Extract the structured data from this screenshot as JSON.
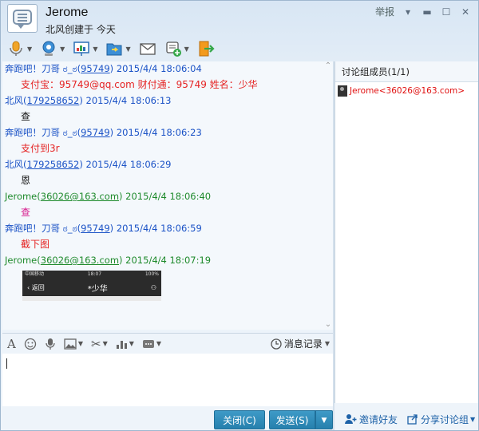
{
  "header": {
    "name": "Jerome",
    "subtitle": "北风创建于 今天"
  },
  "window_controls": {
    "report": "举报"
  },
  "colors": {
    "red": "#e52424",
    "blue": "#1a52c6",
    "green": "#1e8a2c",
    "pink": "#d61a8c"
  },
  "messages": [
    {
      "sender": "奔跑吧！刀哥 ಠ_ಠ",
      "id": "95749",
      "time": "2015/4/4 18:06:04",
      "color": "blue",
      "body": "支付宝：95749@qq.com  财付通：95749  姓名：少华",
      "body_color": "red"
    },
    {
      "sender": "北风",
      "id": "179258652",
      "time": "2015/4/4 18:06:13",
      "color": "blue",
      "body": "查",
      "body_color": "black"
    },
    {
      "sender": "奔跑吧！刀哥 ಠ_ಠ",
      "id": "95749",
      "time": "2015/4/4 18:06:23",
      "color": "blue",
      "body": "支付到3r",
      "body_color": "red"
    },
    {
      "sender": "北风",
      "id": "179258652",
      "time": "2015/4/4 18:06:29",
      "color": "blue",
      "body": "恩",
      "body_color": "black"
    },
    {
      "sender": "Jerome",
      "id": "36026@163.com",
      "time": "2015/4/4 18:06:40",
      "color": "green",
      "body": "查",
      "body_color": "pink"
    },
    {
      "sender": "奔跑吧！刀哥 ಠ_ಠ",
      "id": "95749",
      "time": "2015/4/4 18:06:59",
      "color": "blue",
      "body": "截下图",
      "body_color": "red"
    },
    {
      "sender": "Jerome",
      "id": "36026@163.com",
      "time": "2015/4/4 18:07:19",
      "color": "green",
      "body": "",
      "body_color": "pink"
    }
  ],
  "screenshot_preview": {
    "carrier": "中国移动",
    "clock": "18:07",
    "battery": "100%",
    "back": "返回",
    "title": "*少华"
  },
  "input_toolbar": {
    "history": "消息记录"
  },
  "buttons": {
    "close": "关闭(C)",
    "send": "发送(S)"
  },
  "side_panel": {
    "title": "讨论组成员(1/1)",
    "members": [
      "Jerome<36026@163.com>"
    ],
    "invite": "邀请好友",
    "share": "分享讨论组"
  }
}
